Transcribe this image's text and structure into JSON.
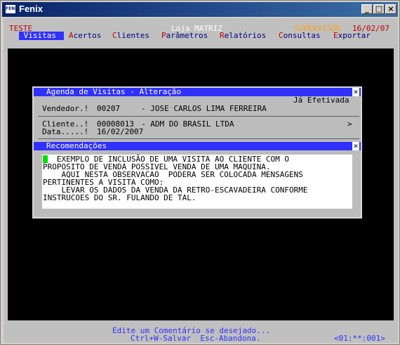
{
  "window": {
    "icon_text": "FENIX",
    "title": "Fenix",
    "buttons": {
      "minimize": "_",
      "maximize": "□",
      "close": "×"
    }
  },
  "header": {
    "left": "TESTE",
    "center": "Loja MATRIZ",
    "role": "SUPERVISOR",
    "date": "16/02/07"
  },
  "menu": {
    "items": [
      {
        "hk": "V",
        "rest": "isitas",
        "active": true
      },
      {
        "hk": "A",
        "rest": "certos",
        "active": false
      },
      {
        "hk": "C",
        "rest": "lientes",
        "active": false
      },
      {
        "hk": "P",
        "rest": "arâmetros",
        "active": false
      },
      {
        "hk": "R",
        "rest": "elatórios",
        "active": false
      },
      {
        "hk": "C",
        "rest": "onsultas",
        "active": false
      },
      {
        "hk": "E",
        "rest": "xportar",
        "active": false
      }
    ]
  },
  "dialog": {
    "title": "Agenda de Visitas - Alteração",
    "close": "×",
    "status": "Já Efetivada",
    "vendedor_label": "Vendedor.!",
    "vendedor_code": "00207",
    "vendedor_name": "- JOSE CARLOS LIMA FERREIRA",
    "cliente_label": "Cliente..!",
    "cliente_code": "00008013",
    "cliente_name": "- ADM DO BRASIL LTDA",
    "cliente_more": ">",
    "data_label": "Data.....!",
    "data_value": "16/02/2007",
    "rec_title": "Recomendações",
    "rec_close": "×",
    "rec_lines": [
      "   EXEMPLO DE INCLUSÃO DE UMA VISITA AO CLIENTE COM O",
      "PROPOSITO DE VENDA POSSIVEL VENDA DE UMA MAQUINA.",
      "    AQUI NESTA OBSERVACAO  PODERA SER COLOCADA MENSAGENS",
      "PERTINENTES A VISITA COMO:",
      "    LEVAR OS DADOS DA VENDA DA RETRO-ESCAVADEIRA CONFORME",
      "INSTRUCOES DO SR. FULANDO DE TAL."
    ]
  },
  "statusbar": {
    "hint1": "Edite um Comentário se desejado...",
    "hint2": "Ctrl+W-Salvar  Esc-Abandona.",
    "position": "<01:**:001>"
  },
  "colors": {
    "title_blue": "#3030ff",
    "menu_text": "#000080",
    "hotkey_red": "#c00000",
    "role_orange": "#ffa020",
    "cursor_green": "#00dd00"
  }
}
